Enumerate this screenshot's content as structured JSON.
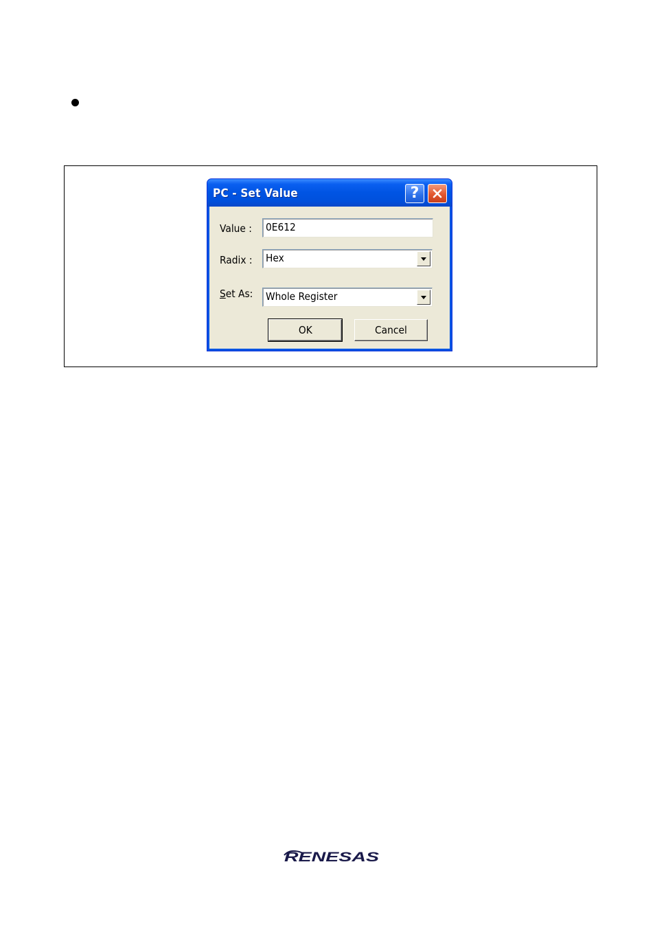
{
  "dialog": {
    "title": "PC - Set Value",
    "value_label": "Value :",
    "value": "0E612",
    "radix_label": "Radix :",
    "radix_selected": "Hex",
    "set_as_label_mnemonic": "S",
    "set_as_label_rest": "et As:",
    "set_as_selected": "Whole Register",
    "ok_label": "OK",
    "cancel_label": "Cancel",
    "help_glyph": "?"
  },
  "footer": {
    "logo_text": "RENESAS"
  },
  "colors": {
    "titlebar": "#0054e3",
    "dialog_face": "#ece9d8",
    "close_button": "#e2572e"
  }
}
